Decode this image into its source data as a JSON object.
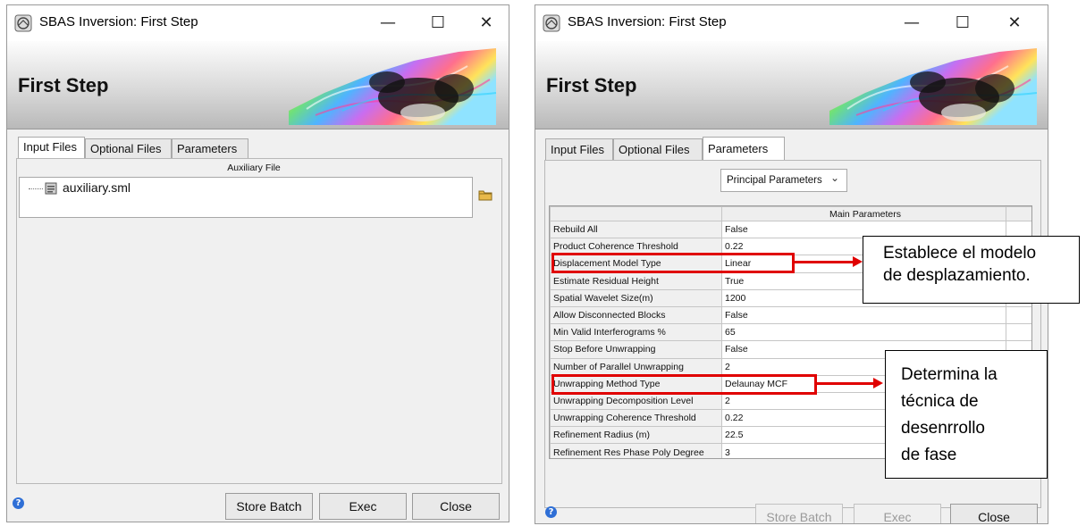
{
  "window_title": "SBAS Inversion: First Step",
  "header_title": "First Step",
  "window_controls": {
    "minimize": "—",
    "maximize": "☐",
    "close": "✕"
  },
  "tabs": [
    "Input Files",
    "Optional Files",
    "Parameters"
  ],
  "left": {
    "active_tab": "Input Files",
    "auxiliary_header": "Auxiliary File",
    "file_item": "auxiliary.sml"
  },
  "right": {
    "active_tab": "Parameters",
    "dropdown_value": "Principal Parameters",
    "table_header": "Main Parameters",
    "rows": [
      {
        "name": "Rebuild All",
        "value": "False"
      },
      {
        "name": "Product Coherence Threshold",
        "value": "0.22"
      },
      {
        "name": "Displacement Model Type",
        "value": "Linear"
      },
      {
        "name": "Estimate Residual Height",
        "value": "True"
      },
      {
        "name": "Spatial Wavelet Size(m)",
        "value": "1200"
      },
      {
        "name": "Allow Disconnected Blocks",
        "value": "False"
      },
      {
        "name": "Min Valid Interferograms %",
        "value": "65"
      },
      {
        "name": "Stop Before Unwrapping",
        "value": "False"
      },
      {
        "name": "Number of Parallel Unwrapping",
        "value": "2"
      },
      {
        "name": "Unwrapping Method Type",
        "value": "Delaunay MCF"
      },
      {
        "name": "Unwrapping Decomposition Level",
        "value": "2"
      },
      {
        "name": "Unwrapping Coherence Threshold",
        "value": "0.22"
      },
      {
        "name": "Refinement Radius (m)",
        "value": "22.5"
      },
      {
        "name": "Refinement Res Phase Poly Degree",
        "value": "3"
      }
    ]
  },
  "buttons": {
    "store_batch": "Store Batch",
    "exec": "Exec",
    "close": "Close"
  },
  "annotations": {
    "callout1_line1": "Establece el modelo",
    "callout1_line2": "de desplazamiento.",
    "callout2_line1": "Determina la",
    "callout2_line2": "técnica de",
    "callout2_line3": "desenrrollo",
    "callout2_line4": "de fase"
  },
  "colors": {
    "highlight_red": "#e00000",
    "help_blue": "#2f6fd6"
  }
}
